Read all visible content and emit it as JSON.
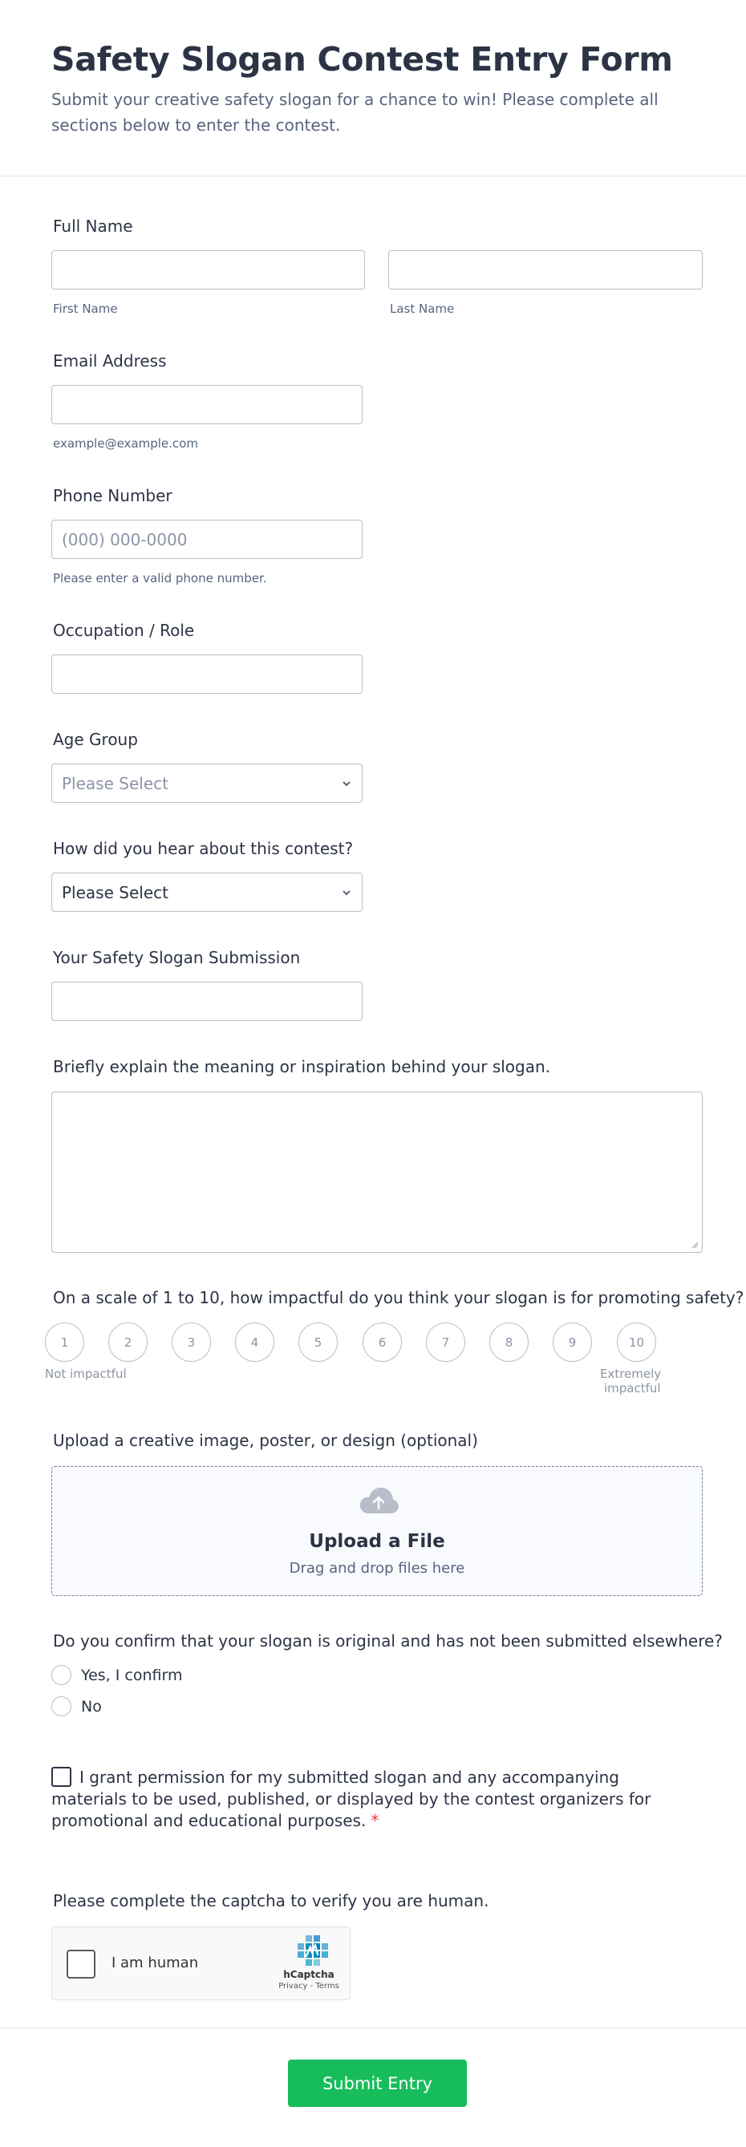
{
  "form": {
    "title": "Safety Slogan Contest Entry Form",
    "subtitle": "Submit your creative safety slogan for a chance to win! Please complete all sections below to enter the contest."
  },
  "full_name": {
    "label": "Full Name",
    "first_sublabel": "First Name",
    "last_sublabel": "Last Name"
  },
  "email": {
    "label": "Email Address",
    "sublabel": "example@example.com"
  },
  "phone": {
    "label": "Phone Number",
    "placeholder": "(000) 000-0000",
    "sublabel": "Please enter a valid phone number."
  },
  "occupation": {
    "label": "Occupation / Role"
  },
  "age_group": {
    "label": "Age Group",
    "selected": "Please Select"
  },
  "hear_about": {
    "label": "How did you hear about this contest?",
    "selected": "Please Select"
  },
  "slogan": {
    "label": "Your Safety Slogan Submission"
  },
  "explanation": {
    "label": "Briefly explain the meaning or inspiration behind your slogan."
  },
  "rating": {
    "label": "On a scale of 1 to 10, how impactful do you think your slogan is for promoting safety?",
    "options": [
      "1",
      "2",
      "3",
      "4",
      "5",
      "6",
      "7",
      "8",
      "9",
      "10"
    ],
    "min_label": "Not impactful",
    "max_label_line1": "Extremely",
    "max_label_line2": "impactful"
  },
  "upload": {
    "label": "Upload a creative image, poster, or design (optional)",
    "title": "Upload a File",
    "subtitle": "Drag and drop files here",
    "icon": "cloud-upload-icon"
  },
  "originality": {
    "label": "Do you confirm that your slogan is original and has not been submitted elsewhere?",
    "options": [
      "Yes, I confirm",
      "No"
    ]
  },
  "consent": {
    "text": "I grant permission for my submitted slogan and any accompanying materials to be used, published, or displayed by the contest organizers for promotional and educational purposes.",
    "required_mark": "*"
  },
  "captcha": {
    "label": "Please complete the captcha to verify you are human.",
    "checkbox_label": "I am human",
    "brand": "hCaptcha",
    "terms": "Privacy - Terms"
  },
  "submit": {
    "label": "Submit Entry"
  },
  "colors": {
    "accent": "#18bd5b",
    "text": "#2c3345",
    "muted": "#57647e",
    "border": "#b8bdc9",
    "required": "#f23a3c"
  }
}
